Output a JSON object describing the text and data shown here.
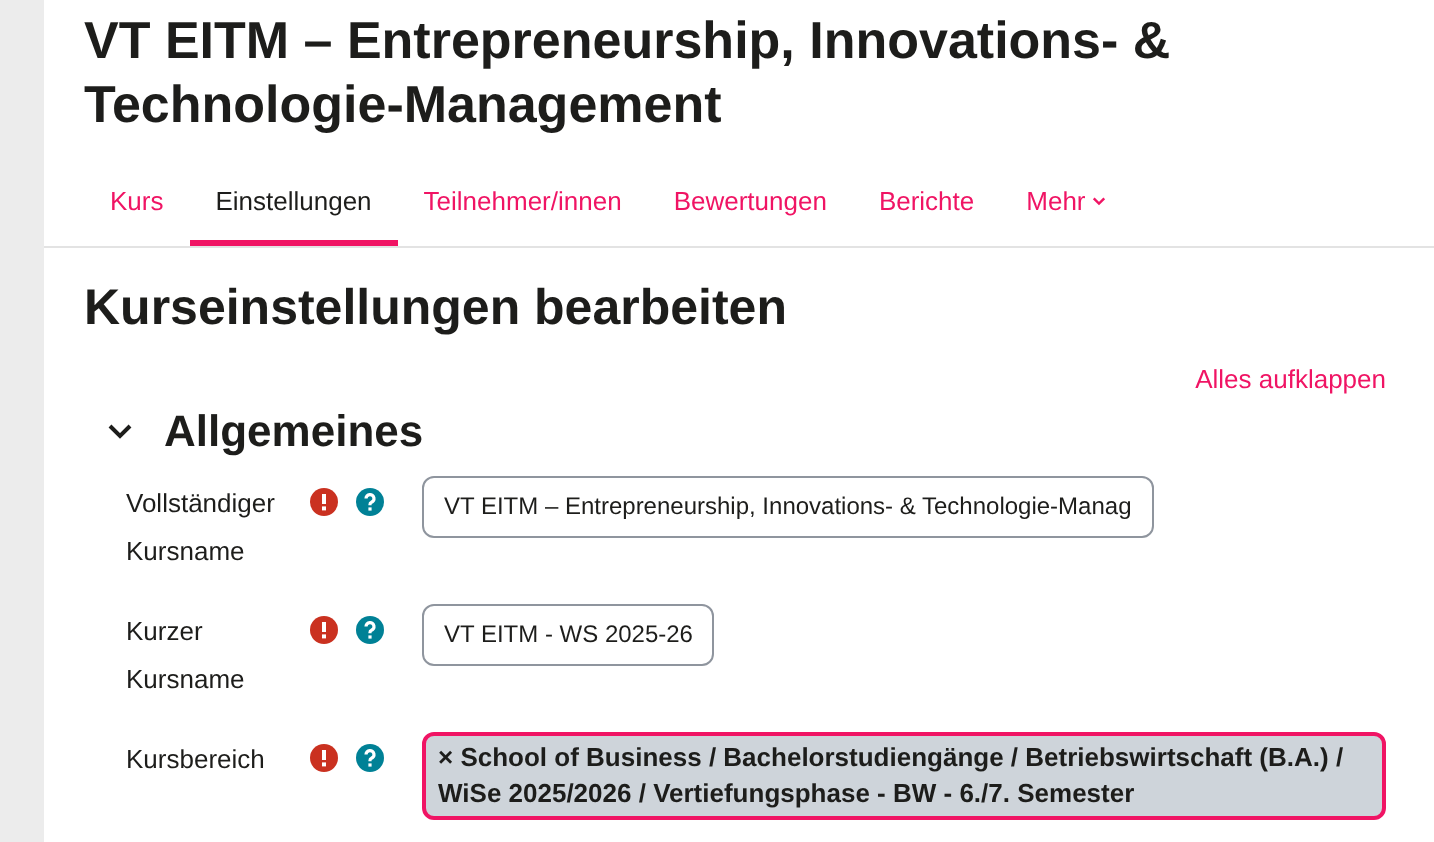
{
  "course_title": "VT EITM – Entrepreneurship, Innovations- & Technologie-Management",
  "tabs": [
    {
      "label": "Kurs",
      "selected": false
    },
    {
      "label": "Einstellungen",
      "selected": true
    },
    {
      "label": "Teilnehmer/innen",
      "selected": false
    },
    {
      "label": "Bewertungen",
      "selected": false
    },
    {
      "label": "Berichte",
      "selected": false
    },
    {
      "label": "Mehr",
      "selected": false,
      "dropdown": true
    }
  ],
  "page_heading": "Kurseinstellungen bearbeiten",
  "expand_all": "Alles aufklappen",
  "section": {
    "title": "Allgemeines",
    "expanded": true,
    "fields": [
      {
        "kind": "text",
        "label": "Vollständiger Kursname",
        "required": true,
        "value": "VT EITM – Entrepreneurship, Innovations- & Technologie-Manag"
      },
      {
        "kind": "text",
        "label": "Kurzer Kursname",
        "required": true,
        "value": "VT EITM - WS 2025-26"
      },
      {
        "kind": "selection",
        "label": "Kursbereich",
        "required": true,
        "remove": "×",
        "value": "School of Business / Bachelorstudiengänge / Betriebswirtschaft (B.A.) / WiSe 2025/2026 / Vertiefungsphase - BW - 6./7. Semester"
      }
    ]
  }
}
